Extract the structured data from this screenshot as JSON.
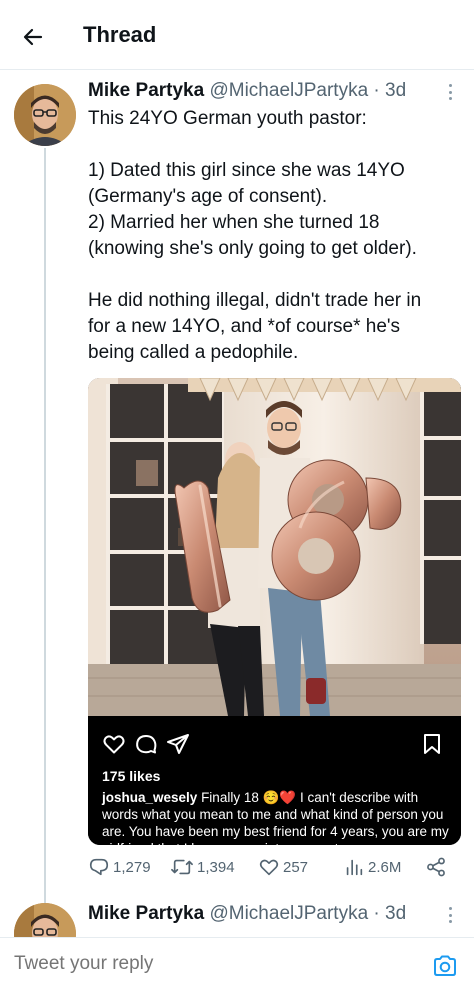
{
  "header": {
    "title": "Thread",
    "back_icon": "arrow-left-icon"
  },
  "tweet": {
    "author_name": "Mike Partyka",
    "handle": "@MichaelJPartyka",
    "separator": "·",
    "time": "3d",
    "text_lines": [
      "This 24YO German youth pastor:",
      "",
      "1) Dated this girl since she was 14YO",
      "(Germany's age of consent).",
      "2) Married her when she turned 18",
      "(knowing she's only going to get older).",
      "",
      "He did nothing illegal, didn't trade her in",
      "for a new 14YO, and *of course* he's",
      "being called a pedophile."
    ],
    "media": {
      "likes": "175 likes",
      "caption_user": "joshua_wesely",
      "caption_text": " Finally 18 ☺️❤️ I can't describe with words what you mean to me and what kind of person you are. You have been my best friend for 4 years, you are my girlfriend that I love, appreciate, respect"
    },
    "stats": {
      "replies": "1,279",
      "retweets": "1,394",
      "likes": "257",
      "views": "2.6M"
    }
  },
  "next_tweet": {
    "author_name": "Mike Partyka",
    "handle": "@MichaelJPartyka",
    "separator": "·",
    "time": "3d"
  },
  "reply_bar": {
    "placeholder": "Tweet your reply",
    "camera_icon": "camera-icon"
  },
  "colors": {
    "accent": "#1d9bf0",
    "secondary_text": "#536471",
    "thread_line": "#cfd9de"
  }
}
